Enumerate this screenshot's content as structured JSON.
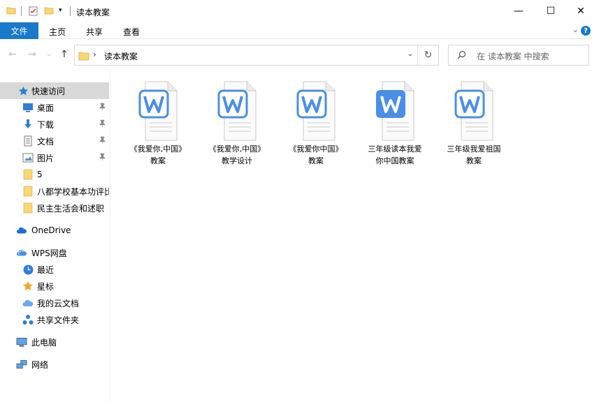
{
  "window": {
    "title": "读本教案",
    "minimize_glyph": "—",
    "maximize_glyph": "☐",
    "close_glyph": "✕"
  },
  "ribbon": {
    "file_tab": "文件",
    "tabs": [
      "主页",
      "共享",
      "查看"
    ],
    "expand_glyph": "⌄",
    "help_glyph": "?"
  },
  "navigation": {
    "back_glyph": "←",
    "forward_glyph": "→",
    "recent_glyph": "⌄",
    "up_glyph": "↑",
    "breadcrumb_separator": "›",
    "path": "读本教案",
    "dropdown_glyph": "⌄",
    "refresh_glyph": "↻"
  },
  "search": {
    "placeholder": "在 读本教案 中搜索",
    "icon": "search-icon"
  },
  "sidebar": {
    "items": [
      {
        "label": "快速访问",
        "icon": "star-icon"
      },
      {
        "label": "桌面",
        "icon": "desktop-icon",
        "pinned": true
      },
      {
        "label": "下载",
        "icon": "download-icon",
        "pinned": true
      },
      {
        "label": "文档",
        "icon": "document-icon",
        "pinned": true
      },
      {
        "label": "图片",
        "icon": "picture-icon",
        "pinned": true
      },
      {
        "label": "5",
        "icon": "folder-icon"
      },
      {
        "label": "八都学校基本功评比",
        "icon": "folder-icon"
      },
      {
        "label": "民主生活会和述职",
        "icon": "folder-icon"
      },
      {
        "label": "OneDrive",
        "icon": "onedrive-icon"
      },
      {
        "label": "WPS网盘",
        "icon": "wps-cloud-icon"
      },
      {
        "label": "最近",
        "icon": "clock-icon"
      },
      {
        "label": "星标",
        "icon": "star-icon"
      },
      {
        "label": "我的云文档",
        "icon": "cloud-doc-icon"
      },
      {
        "label": "共享文件夹",
        "icon": "shared-folder-icon"
      },
      {
        "label": "此电脑",
        "icon": "computer-icon"
      },
      {
        "label": "网络",
        "icon": "network-icon"
      }
    ],
    "pin_glyph": "📌"
  },
  "files": [
    {
      "line1": "《我爱你,中国》",
      "line2": "教案",
      "icon": "wps-word-icon"
    },
    {
      "line1": "《我爱你,中国》",
      "line2": "教学设计",
      "icon": "wps-word-icon"
    },
    {
      "line1": "《我爱你中国》",
      "line2": "教案",
      "icon": "wps-word-icon"
    },
    {
      "line1": "三年级读本我爱",
      "line2": "你中国教案",
      "icon": "wps-word-icon-filled"
    },
    {
      "line1": "三年级我爱祖国",
      "line2": "教案",
      "icon": "wps-word-icon"
    }
  ],
  "colors": {
    "accent": "#1979ca",
    "selected": "#d9d9d9",
    "folder": "#f8d775",
    "wps_blue": "#4a8fe7"
  }
}
